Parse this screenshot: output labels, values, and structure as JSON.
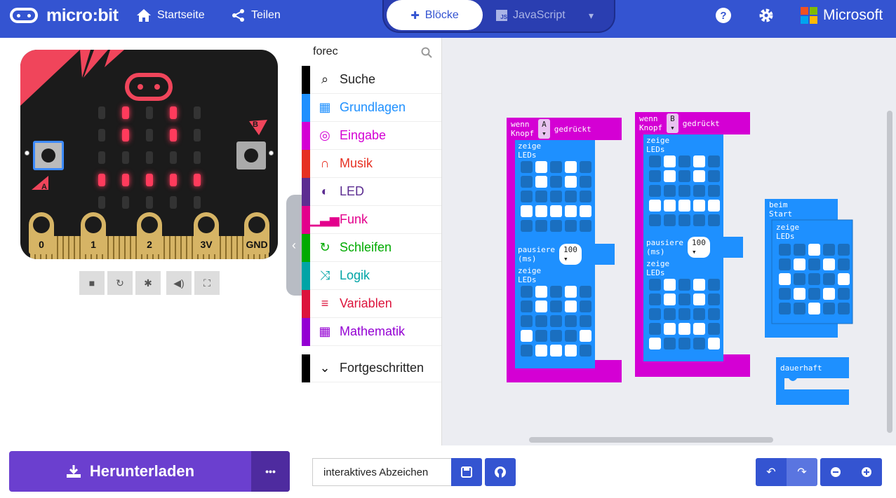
{
  "header": {
    "logo": "micro:bit",
    "home_label": "Startseite",
    "share_label": "Teilen",
    "blocks_label": "Blöcke",
    "js_label": "JavaScript",
    "brand": "Microsoft"
  },
  "simulator": {
    "pins": [
      "0",
      "1",
      "2",
      "3V",
      "GND"
    ],
    "button_a": "A",
    "button_b": "B"
  },
  "toolbox": {
    "search_value": "forec",
    "categories": [
      {
        "label": "Suche",
        "color": "#000000",
        "icon": "search-icon"
      },
      {
        "label": "Grundlagen",
        "color": "#1e90ff",
        "icon": "grid-icon"
      },
      {
        "label": "Eingabe",
        "color": "#d400d4",
        "icon": "target-icon"
      },
      {
        "label": "Musik",
        "color": "#e63022",
        "icon": "headphones-icon"
      },
      {
        "label": "LED",
        "color": "#5c2d91",
        "icon": "toggle-icon"
      },
      {
        "label": "Funk",
        "color": "#e3008c",
        "icon": "signal-icon"
      },
      {
        "label": "Schleifen",
        "color": "#00aa00",
        "icon": "loop-icon"
      },
      {
        "label": "Logik",
        "color": "#00a4a6",
        "icon": "shuffle-icon"
      },
      {
        "label": "Variablen",
        "color": "#dc143c",
        "icon": "list-icon"
      },
      {
        "label": "Mathematik",
        "color": "#9400d3",
        "icon": "calculator-icon"
      },
      {
        "label": "Fortgeschritten",
        "color": "#000000",
        "icon": "chevron-down-icon"
      }
    ]
  },
  "workspace": {
    "block_a": {
      "event": "wenn Knopf",
      "button": "A",
      "suffix": "gedrückt",
      "show_leds": "zeige LEDs",
      "pause": "pausiere (ms)",
      "pause_value": "100"
    },
    "block_b": {
      "event": "wenn Knopf",
      "button": "B",
      "suffix": "gedrückt",
      "show_leds": "zeige LEDs",
      "pause": "pausiere (ms)",
      "pause_value": "100"
    },
    "start": {
      "label": "beim Start",
      "show_leds": "zeige LEDs"
    },
    "forever": {
      "label": "dauerhaft"
    }
  },
  "footer": {
    "download_label": "Herunterladen",
    "more_label": "•••",
    "project_name": "interaktives Abzeichen"
  }
}
